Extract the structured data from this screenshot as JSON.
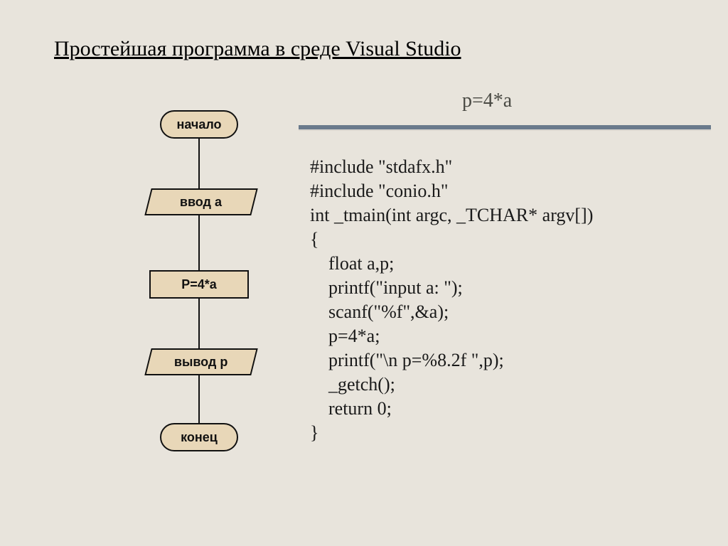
{
  "title": "Простейшая программа в среде Visual Studio",
  "formula": "p=4*a",
  "flow": {
    "start": "начало",
    "input": "ввод  a",
    "process": "P=4*a",
    "output": "вывод  p",
    "end": "конец"
  },
  "code": "#include \"stdafx.h\"\n#include \"conio.h\"\nint _tmain(int argc, _TCHAR* argv[])\n{\n    float a,p;\n    printf(\"input a: \");\n    scanf(\"%f\",&a);\n    p=4*a;\n    printf(\"\\n p=%8.2f \",p);\n    _getch();\n    return 0;\n}"
}
